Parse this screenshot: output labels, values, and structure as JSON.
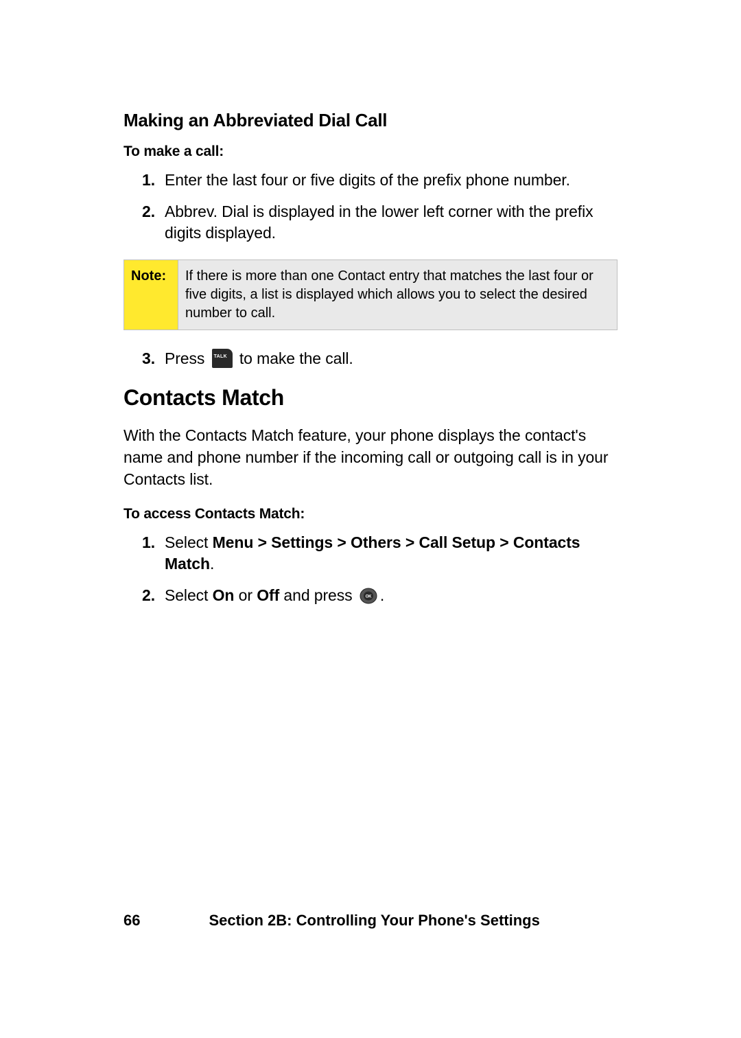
{
  "section1": {
    "heading": "Making an Abbreviated Dial Call",
    "lead": "To make a call:",
    "steps12": [
      {
        "num": "1.",
        "text": "Enter the last four or five digits of the prefix phone number."
      },
      {
        "num": "2.",
        "text": "Abbrev. Dial is displayed in the lower left corner with the prefix digits displayed."
      }
    ],
    "note": {
      "label": "Note:",
      "body": "If there is more than one Contact entry that matches the last four or five digits, a list is displayed which allows you to select the desired number to call."
    },
    "step3": {
      "num": "3.",
      "pre": "Press ",
      "post": " to make the call."
    }
  },
  "section2": {
    "heading": "Contacts Match",
    "para": "With the Contacts Match feature, your phone displays the contact's name and phone number if the incoming call or outgoing call is in your Contacts list.",
    "lead": "To access Contacts Match:",
    "steps": {
      "s1": {
        "num": "1.",
        "pre": "Select ",
        "bold": "Menu > Settings > Others > Call Setup > Contacts Match",
        "post": "."
      },
      "s2": {
        "num": "2.",
        "a": "Select ",
        "b": "On",
        "c": " or ",
        "d": "Off",
        "e": " and press ",
        "f": "."
      }
    }
  },
  "footer": {
    "page": "66",
    "section": "Section 2B: Controlling Your Phone's Settings"
  }
}
